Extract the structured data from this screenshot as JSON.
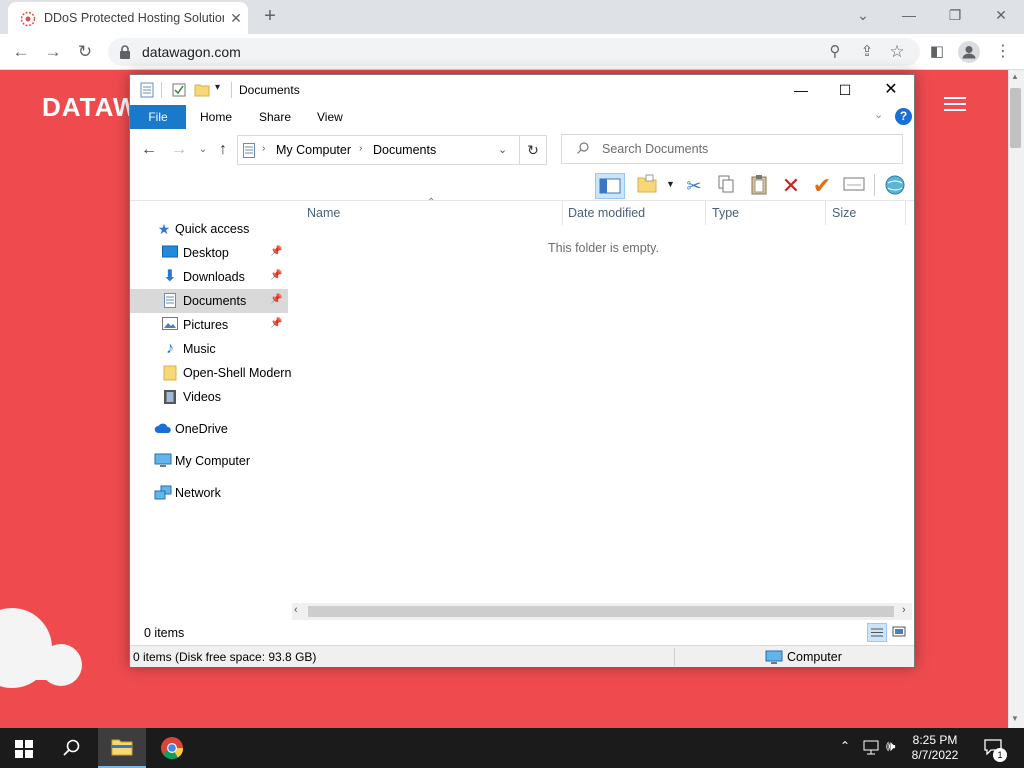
{
  "browser": {
    "tab_title": "DDoS Protected Hosting Solutions",
    "url": "datawagon.com",
    "tab_close": "✕",
    "new_tab": "+"
  },
  "page": {
    "logo_text": "DATAW"
  },
  "explorer": {
    "title": "Documents",
    "ribbon_tabs": [
      "File",
      "Home",
      "Share",
      "View"
    ],
    "help_label": "?",
    "breadcrumb": [
      "My Computer",
      "Documents"
    ],
    "search_placeholder": "Search Documents",
    "nav": {
      "quick_access": "Quick access",
      "items": [
        {
          "label": "Desktop",
          "pinned": true
        },
        {
          "label": "Downloads",
          "pinned": true
        },
        {
          "label": "Documents",
          "pinned": true,
          "selected": true
        },
        {
          "label": "Pictures",
          "pinned": true
        },
        {
          "label": "Music",
          "pinned": false
        },
        {
          "label": "Open-Shell Modern",
          "pinned": false
        },
        {
          "label": "Videos",
          "pinned": false
        }
      ],
      "onedrive": "OneDrive",
      "my_computer": "My Computer",
      "network": "Network"
    },
    "columns": [
      "Name",
      "Date modified",
      "Type",
      "Size"
    ],
    "empty_message": "This folder is empty.",
    "item_count": "0 items",
    "status_left": "0 items (Disk free space: 93.8 GB)",
    "status_right": "Computer"
  },
  "taskbar": {
    "time": "8:25 PM",
    "date": "8/7/2022",
    "notification_count": "1"
  },
  "colors": {
    "page_red": "#ef4b4f",
    "file_tab_blue": "#1979ca",
    "taskbar": "#1b1b1b"
  }
}
